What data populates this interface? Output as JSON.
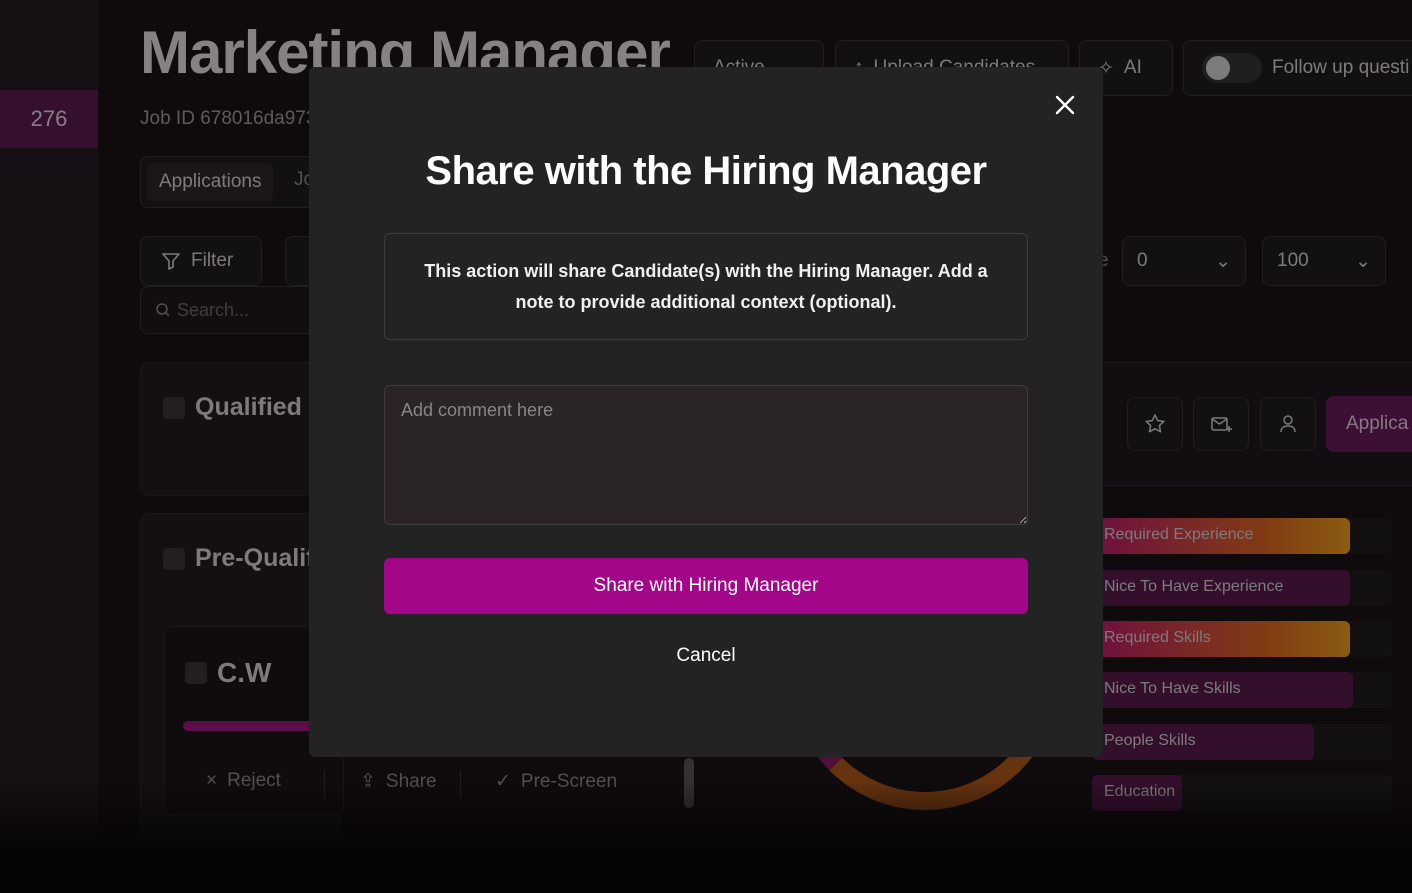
{
  "sidebar": {
    "count": "276"
  },
  "job": {
    "title": "Marketing Manager",
    "id_label": "Job ID 678016da973"
  },
  "toolbar": {
    "status_label": "Active",
    "upload_label": "Upload Candidates",
    "ai_label": "AI",
    "follow_up_label": "Follow up questi"
  },
  "tabs": {
    "applications": "Applications",
    "next_partial": "Jo"
  },
  "filters": {
    "filter_label": "Filter",
    "search_placeholder": "Search...",
    "range_label_partial": "e",
    "range_min": "0",
    "range_max": "100"
  },
  "stages": {
    "qualified": "Qualified",
    "prequalified_partial": "Pre-Qualif"
  },
  "candidate": {
    "initials": "C.W",
    "actions": {
      "reject": "Reject",
      "share": "Share",
      "prescreen": "Pre-Screen"
    }
  },
  "right_panel": {
    "applications_partial": "Applica",
    "scores": [
      {
        "label": "Required Experience",
        "fill": 0.86,
        "style": "hot"
      },
      {
        "label": "Nice To Have Experience",
        "fill": 0.86,
        "style": "pink"
      },
      {
        "label": "Required Skills",
        "fill": 0.86,
        "style": "hot"
      },
      {
        "label": "Nice To Have Skills",
        "fill": 0.87,
        "style": "pink"
      },
      {
        "label": "People Skills",
        "fill": 0.74,
        "style": "pink"
      },
      {
        "label": "Education",
        "fill": 0.3,
        "style": "pink"
      }
    ]
  },
  "modal": {
    "title": "Share with the Hiring Manager",
    "description": "This action will share Candidate(s) with the Hiring Manager. Add a note to provide additional context (optional).",
    "comment_placeholder": "Add comment here",
    "submit_label": "Share with Hiring Manager",
    "cancel_label": "Cancel"
  },
  "colors": {
    "accent": "#a4068a",
    "modal_bg": "#232323",
    "score_gradient_end": "#f0a020"
  }
}
